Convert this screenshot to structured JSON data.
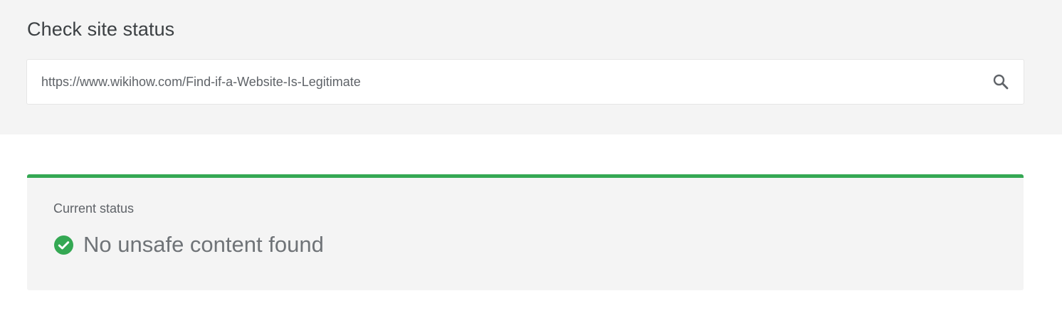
{
  "header": {
    "title": "Check site status"
  },
  "search": {
    "value": "https://www.wikihow.com/Find-if-a-Website-Is-Legitimate",
    "icon": "search-icon"
  },
  "result": {
    "label": "Current status",
    "status_text": "No unsafe content found",
    "status_icon": "check-circle-icon",
    "accent_color": "#34a853"
  }
}
